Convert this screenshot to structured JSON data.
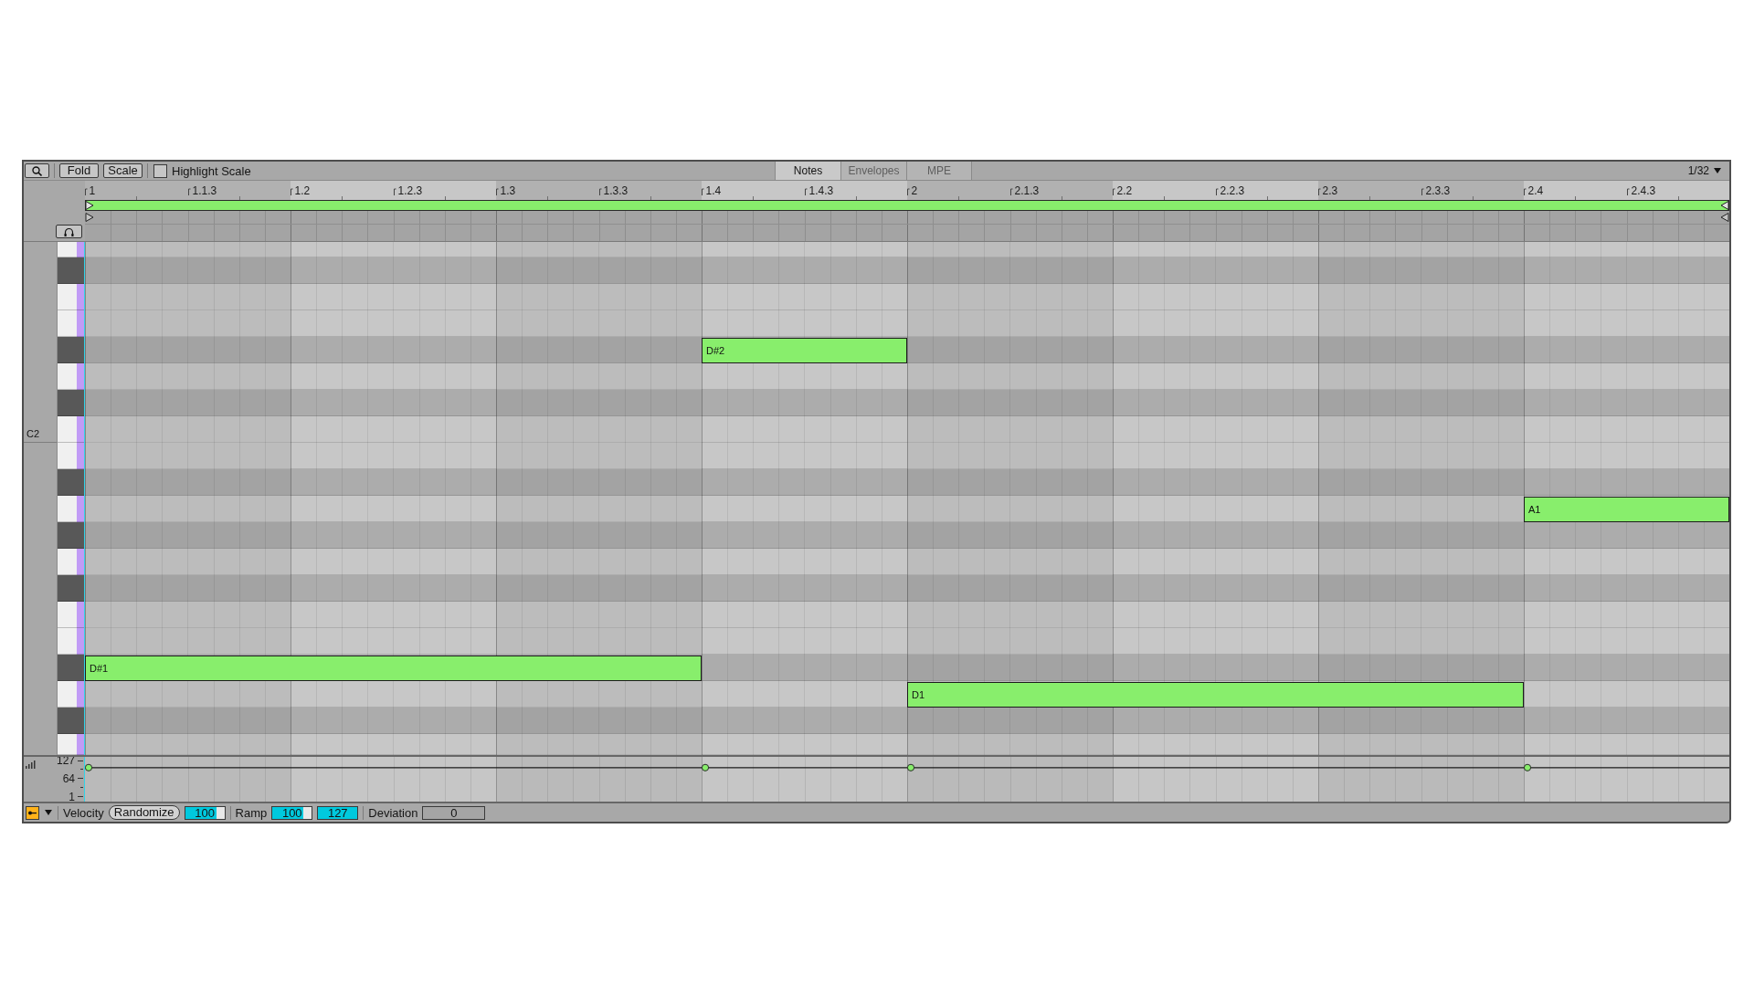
{
  "toolbar": {
    "buttons": [
      "Fold",
      "Scale"
    ],
    "highlight_scale": {
      "label": "Highlight Scale",
      "checked": false
    },
    "tabs": [
      {
        "label": "Notes",
        "selected": true
      },
      {
        "label": "Envelopes",
        "selected": false
      },
      {
        "label": "MPE",
        "selected": false
      }
    ],
    "grid_menu": "1/32"
  },
  "ruler": {
    "marks": [
      "1",
      "1.1.3",
      "1.2",
      "1.2.3",
      "1.3",
      "1.3.3",
      "1.4",
      "1.4.3",
      "2",
      "2.1.3",
      "2.2",
      "2.2.3",
      "2.3",
      "2.3.3",
      "2.4",
      "2.4.3"
    ]
  },
  "piano_roll": {
    "keys": [
      {
        "kind": "white"
      },
      {
        "kind": "black"
      },
      {
        "kind": "white"
      },
      {
        "kind": "white"
      },
      {
        "kind": "black",
        "note": {
          "label": "D#2"
        }
      },
      {
        "kind": "white"
      },
      {
        "kind": "black"
      },
      {
        "kind": "white",
        "label": "C2"
      },
      {
        "kind": "white"
      },
      {
        "kind": "black"
      },
      {
        "kind": "white",
        "note": {
          "label": "A1"
        }
      },
      {
        "kind": "black"
      },
      {
        "kind": "white"
      },
      {
        "kind": "black"
      },
      {
        "kind": "white"
      },
      {
        "kind": "white"
      },
      {
        "kind": "black",
        "note": {
          "label": "D#1"
        }
      },
      {
        "kind": "white",
        "note": {
          "label": "D1"
        }
      },
      {
        "kind": "black"
      },
      {
        "kind": "white"
      }
    ]
  },
  "velocity_lane": {
    "scale": [
      "127",
      "64",
      "1"
    ]
  },
  "bottom_bar": {
    "lane_toggle": {
      "on": true
    },
    "velocity": {
      "label": "Velocity",
      "randomize": "Randomize",
      "field": {
        "value": "100",
        "level": 0.79
      }
    },
    "ramp": {
      "label": "Ramp",
      "fields": [
        {
          "value": "100",
          "level": 0.79
        },
        {
          "value": "127",
          "level": 1
        }
      ]
    },
    "deviation": {
      "label": "Deviation",
      "value": "0"
    }
  }
}
